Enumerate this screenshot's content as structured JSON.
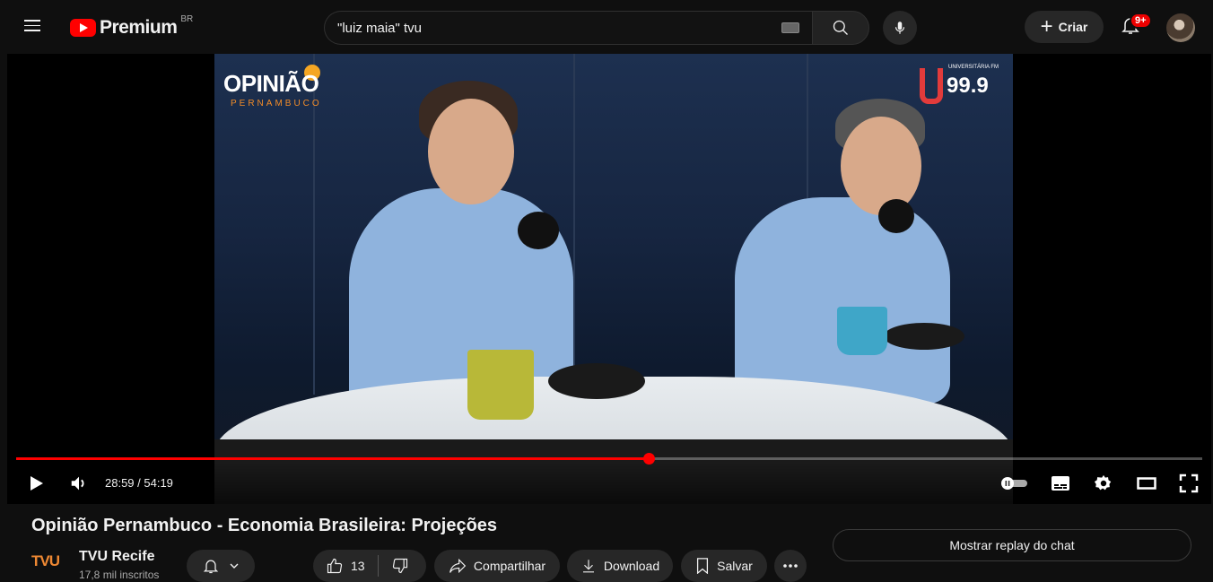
{
  "header": {
    "logo_text": "Premium",
    "country_code": "BR",
    "search_value": "\"luiz maia\" tvu",
    "create_label": "Criar",
    "notification_count": "9+"
  },
  "player": {
    "show_logo_main": "OPINIÃO",
    "show_logo_sub": "PERNAMBUCO",
    "radio_logo_name": "UNIVERSITÁRIA FM",
    "radio_logo_number": "99.9",
    "current_time": "28:59",
    "duration": "54:19",
    "time_display": "28:59 / 54:19",
    "progress_fraction": 0.5335,
    "accent_color": "#ff0000"
  },
  "video": {
    "title": "Opinião Pernambuco - Economia Brasileira: Projeções"
  },
  "channel": {
    "logo_text": "TVU",
    "name": "TVU Recife",
    "subscribers": "17,8 mil inscritos"
  },
  "actions": {
    "like_count": "13",
    "share_label": "Compartilhar",
    "download_label": "Download",
    "save_label": "Salvar"
  },
  "chat": {
    "replay_label": "Mostrar replay do chat"
  }
}
